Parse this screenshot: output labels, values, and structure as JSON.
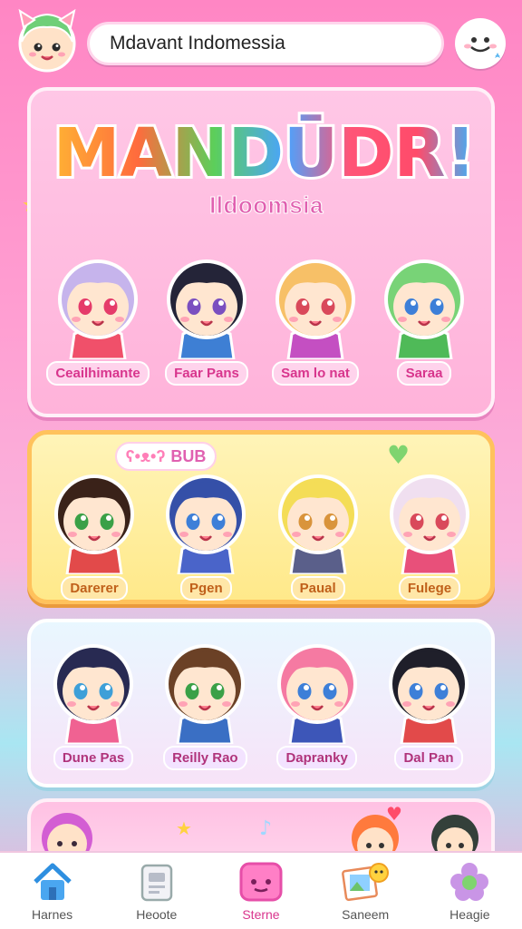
{
  "header": {
    "search_text": "Mdavant Indomessia"
  },
  "hero": {
    "logo_text": "MANDŪDR!",
    "subtitle": "Ildoomsia",
    "characters": [
      {
        "name": "Ceailhimante",
        "hair": "#c6b4ec",
        "shirt": "#f0506a",
        "eyes": "#e53b6a"
      },
      {
        "name": "Faar Pans",
        "hair": "#242438",
        "shirt": "#3e7fd4",
        "eyes": "#7a4fc0"
      },
      {
        "name": "Sam lo nat",
        "hair": "#f7c067",
        "shirt": "#c44fc2",
        "eyes": "#d9495b"
      },
      {
        "name": "Saraa",
        "hair": "#78d377",
        "shirt": "#4fba58",
        "eyes": "#3d7fd8"
      }
    ]
  },
  "panel2": {
    "badge": "BUB",
    "characters": [
      {
        "name": "Darerer",
        "hair": "#3a2219",
        "shirt": "#e24a4a",
        "eyes": "#3aa047"
      },
      {
        "name": "Pgen",
        "hair": "#3550a8",
        "shirt": "#4a64c9",
        "eyes": "#3d7fd8"
      },
      {
        "name": "Paual",
        "hair": "#f4dd57",
        "shirt": "#5a5f8a",
        "eyes": "#d9943b"
      },
      {
        "name": "Fulege",
        "hair": "#f0dff0",
        "shirt": "#e8507a",
        "eyes": "#d9495b"
      }
    ]
  },
  "panel3": {
    "characters": [
      {
        "name": "Dune Pas",
        "hair": "#282a52",
        "shirt": "#f06292",
        "eyes": "#3d9fd8"
      },
      {
        "name": "Reilly Rao",
        "hair": "#6b4126",
        "shirt": "#3a6fc4",
        "eyes": "#3aa047"
      },
      {
        "name": "Dapranky",
        "hair": "#f57aa2",
        "shirt": "#3d56b8",
        "eyes": "#3d7fd8"
      },
      {
        "name": "Dal Pan",
        "hair": "#1f1f2a",
        "shirt": "#e24a4a",
        "eyes": "#3d7fd8"
      }
    ]
  },
  "nav": [
    {
      "label": "Harnes",
      "icon": "home-icon"
    },
    {
      "label": "Heoote",
      "icon": "card-icon"
    },
    {
      "label": "Sterne",
      "icon": "chat-icon"
    },
    {
      "label": "Saneem",
      "icon": "gallery-icon"
    },
    {
      "label": "Heagie",
      "icon": "flower-icon"
    }
  ],
  "colors": {
    "accent": "#e060b0",
    "panel_gold": "#ffc25c",
    "panel_blue": "#9fd3e4"
  }
}
